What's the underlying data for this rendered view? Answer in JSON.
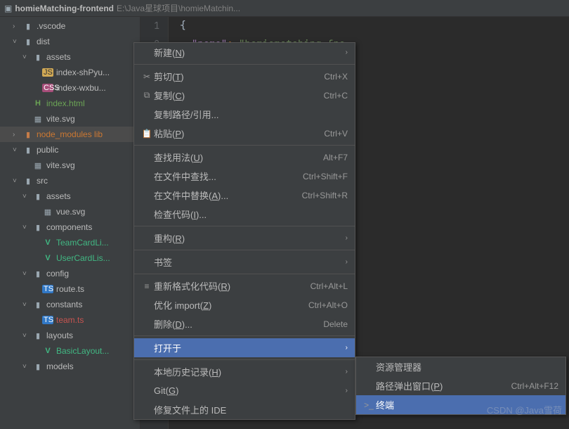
{
  "header": {
    "title": "homieMatching-frontend",
    "path": "E:\\Java星球项目\\homieMatchin..."
  },
  "tree": [
    {
      "d": 1,
      "a": ">",
      "i": "folder",
      "label": ".vscode"
    },
    {
      "d": 1,
      "a": "v",
      "i": "folder",
      "label": "dist"
    },
    {
      "d": 2,
      "a": "v",
      "i": "folder",
      "label": "assets"
    },
    {
      "d": 3,
      "a": "",
      "i": "js",
      "label": "index-shPyu..."
    },
    {
      "d": 3,
      "a": "",
      "i": "css",
      "label": "index-wxbu..."
    },
    {
      "d": 2,
      "a": "",
      "i": "html",
      "label": "index.html",
      "cls": "label-green"
    },
    {
      "d": 2,
      "a": "",
      "i": "svg",
      "label": "vite.svg"
    },
    {
      "d": 1,
      "a": ">",
      "i": "folder-o",
      "label": "node_modules lib",
      "cls": "label-orange",
      "hl": true
    },
    {
      "d": 1,
      "a": "v",
      "i": "folder",
      "label": "public"
    },
    {
      "d": 2,
      "a": "",
      "i": "svg",
      "label": "vite.svg"
    },
    {
      "d": 1,
      "a": "v",
      "i": "folder",
      "label": "src"
    },
    {
      "d": 2,
      "a": "v",
      "i": "folder",
      "label": "assets"
    },
    {
      "d": 3,
      "a": "",
      "i": "svg",
      "label": "vue.svg"
    },
    {
      "d": 2,
      "a": "v",
      "i": "folder",
      "label": "components"
    },
    {
      "d": 3,
      "a": "",
      "i": "vue",
      "label": "TeamCardLi...",
      "cls": "label-vue"
    },
    {
      "d": 3,
      "a": "",
      "i": "vue",
      "label": "UserCardLis...",
      "cls": "label-vue"
    },
    {
      "d": 2,
      "a": "v",
      "i": "folder",
      "label": "config"
    },
    {
      "d": 3,
      "a": "",
      "i": "ts",
      "label": "route.ts"
    },
    {
      "d": 2,
      "a": "v",
      "i": "folder",
      "label": "constants"
    },
    {
      "d": 3,
      "a": "",
      "i": "ts",
      "label": "team.ts",
      "cls": "label-red"
    },
    {
      "d": 2,
      "a": "v",
      "i": "folder",
      "label": "layouts"
    },
    {
      "d": 3,
      "a": "",
      "i": "vue",
      "label": "BasicLayout...",
      "cls": "label-vue"
    },
    {
      "d": 2,
      "a": "v",
      "i": "folder",
      "label": "models"
    }
  ],
  "gutter": [
    "1",
    "2"
  ],
  "menu": [
    {
      "t": "item",
      "icon": "",
      "label": "新建(N)",
      "short": "",
      "arrow": true
    },
    {
      "t": "sep"
    },
    {
      "t": "item",
      "icon": "✂",
      "label": "剪切(T)",
      "short": "Ctrl+X"
    },
    {
      "t": "item",
      "icon": "⧉",
      "label": "复制(C)",
      "short": "Ctrl+C"
    },
    {
      "t": "item",
      "icon": "",
      "label": "复制路径/引用...",
      "short": ""
    },
    {
      "t": "item",
      "icon": "📋",
      "label": "粘贴(P)",
      "short": "Ctrl+V"
    },
    {
      "t": "sep"
    },
    {
      "t": "item",
      "icon": "",
      "label": "查找用法(U)",
      "short": "Alt+F7"
    },
    {
      "t": "item",
      "icon": "",
      "label": "在文件中查找...",
      "short": "Ctrl+Shift+F"
    },
    {
      "t": "item",
      "icon": "",
      "label": "在文件中替换(A)...",
      "short": "Ctrl+Shift+R"
    },
    {
      "t": "item",
      "icon": "",
      "label": "检查代码(I)...",
      "short": ""
    },
    {
      "t": "sep"
    },
    {
      "t": "item",
      "icon": "",
      "label": "重构(R)",
      "short": "",
      "arrow": true
    },
    {
      "t": "sep"
    },
    {
      "t": "item",
      "icon": "",
      "label": "书签",
      "short": "",
      "arrow": true
    },
    {
      "t": "sep"
    },
    {
      "t": "item",
      "icon": "≡",
      "label": "重新格式化代码(R)",
      "short": "Ctrl+Alt+L"
    },
    {
      "t": "item",
      "icon": "",
      "label": "优化 import(Z)",
      "short": "Ctrl+Alt+O"
    },
    {
      "t": "item",
      "icon": "",
      "label": "删除(D)...",
      "short": "Delete"
    },
    {
      "t": "sep"
    },
    {
      "t": "item",
      "icon": "",
      "label": "打开于",
      "short": "",
      "arrow": true,
      "sel": true
    },
    {
      "t": "sep"
    },
    {
      "t": "item",
      "icon": "",
      "label": "本地历史记录(H)",
      "short": "",
      "arrow": true
    },
    {
      "t": "item",
      "icon": "",
      "label": "Git(G)",
      "short": "",
      "arrow": true
    },
    {
      "t": "item",
      "icon": "",
      "label": "修复文件上的 IDE",
      "short": ""
    }
  ],
  "submenu": [
    {
      "icon": "",
      "label": "资源管理器",
      "short": ""
    },
    {
      "icon": "",
      "label": "路径弹出窗口(P)",
      "short": "Ctrl+Alt+F12"
    },
    {
      "icon": ">_",
      "label": "终端",
      "short": "",
      "sel": true
    }
  ],
  "watermark": "CSDN @Java雪荷"
}
